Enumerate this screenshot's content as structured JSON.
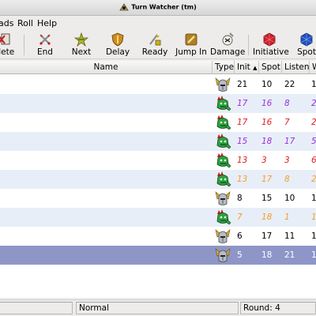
{
  "window": {
    "title": "Turn Watcher (tm)"
  },
  "menu": {
    "items": [
      "ads",
      "Roll",
      "Help"
    ]
  },
  "toolbar": {
    "buttons": [
      {
        "label": "elete",
        "icon": "delete-icon"
      },
      {
        "label": "End",
        "icon": "swords-icon"
      },
      {
        "label": "Next",
        "icon": "next-star-icon"
      },
      {
        "label": "Delay",
        "icon": "shield-icon"
      },
      {
        "label": "Ready",
        "icon": "ready-icon"
      },
      {
        "label": "Jump In",
        "icon": "jump-in-icon"
      },
      {
        "label": "Damage",
        "icon": "damage-icon"
      },
      {
        "label": "Initiative",
        "icon": "d20-icon"
      },
      {
        "label": "Spot",
        "icon": "spot-icon"
      }
    ]
  },
  "table": {
    "columns": {
      "name": "Name",
      "type": "Type",
      "init": "Init",
      "spot": "Spot",
      "listen": "Listen",
      "will": "W"
    },
    "sort_indicator": "▲",
    "rows": [
      {
        "type": "pc",
        "init": "21",
        "spot": "10",
        "listen": "22",
        "will": "1",
        "color": "#000000",
        "bg": "#ffffff",
        "italic": false
      },
      {
        "type": "monster",
        "init": "17",
        "spot": "16",
        "listen": "8",
        "will": "2",
        "color": "#9b30d9",
        "bg": "#e8eef8",
        "italic": true
      },
      {
        "type": "monster",
        "init": "17",
        "spot": "16",
        "listen": "7",
        "will": "2",
        "color": "#e02020",
        "bg": "#ffffff",
        "italic": true
      },
      {
        "type": "monster",
        "init": "15",
        "spot": "18",
        "listen": "17",
        "will": "5",
        "color": "#9b30d9",
        "bg": "#e8eef8",
        "italic": true
      },
      {
        "type": "monster",
        "init": "13",
        "spot": "3",
        "listen": "3",
        "will": "6",
        "color": "#e02020",
        "bg": "#ffffff",
        "italic": true
      },
      {
        "type": "monster",
        "init": "13",
        "spot": "17",
        "listen": "8",
        "will": "2",
        "color": "#f0a030",
        "bg": "#e8eef8",
        "italic": true
      },
      {
        "type": "pc",
        "init": "8",
        "spot": "15",
        "listen": "10",
        "will": "1",
        "color": "#000000",
        "bg": "#ffffff",
        "italic": false
      },
      {
        "type": "monster",
        "init": "7",
        "spot": "18",
        "listen": "1",
        "will": "1",
        "color": "#f0a030",
        "bg": "#e8eef8",
        "italic": true
      },
      {
        "type": "pc",
        "init": "6",
        "spot": "17",
        "listen": "11",
        "will": "1",
        "color": "#000000",
        "bg": "#ffffff",
        "italic": false
      },
      {
        "type": "pc",
        "init": "5",
        "spot": "18",
        "listen": "21",
        "will": "1",
        "color": "#ffffff",
        "bg": "#8e96c8",
        "italic": false,
        "selected": true
      }
    ]
  },
  "status": {
    "mode": "Normal",
    "round": "Round: 4"
  }
}
